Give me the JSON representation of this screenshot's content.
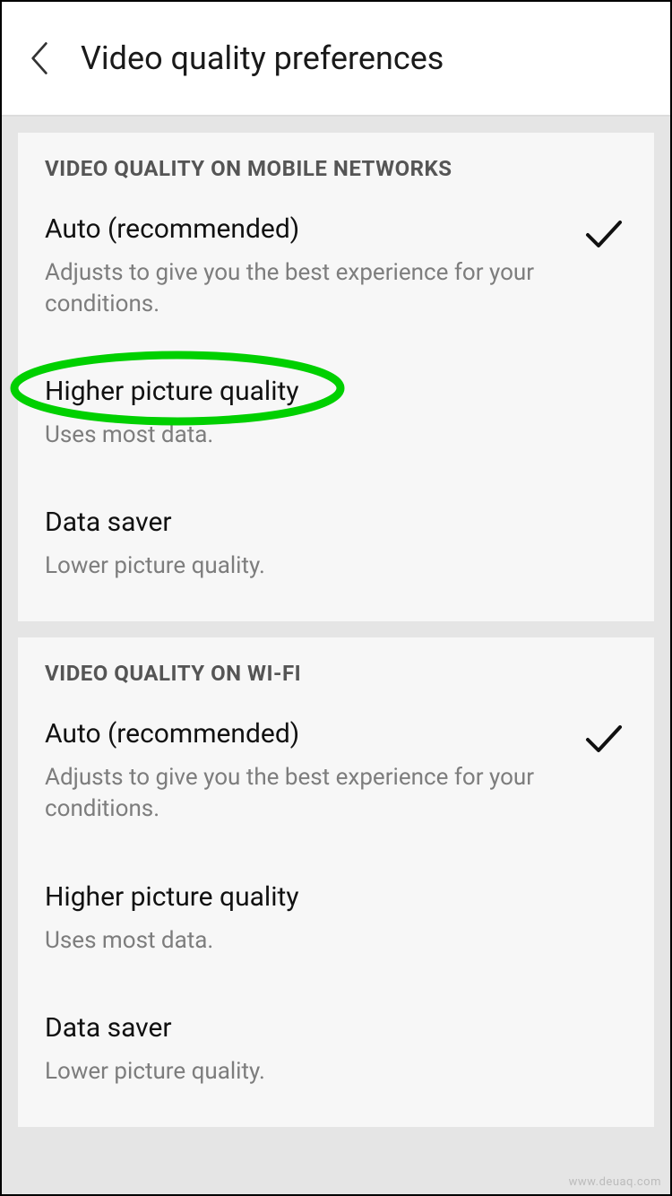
{
  "header": {
    "title": "Video quality preferences"
  },
  "sections": [
    {
      "header": "VIDEO QUALITY ON MOBILE NETWORKS",
      "options": [
        {
          "title": "Auto (recommended)",
          "desc": "Adjusts to give you the best experience for your conditions.",
          "selected": true
        },
        {
          "title": "Higher picture quality",
          "desc": "Uses most data.",
          "selected": false,
          "highlighted": true
        },
        {
          "title": "Data saver",
          "desc": "Lower picture quality.",
          "selected": false
        }
      ]
    },
    {
      "header": "VIDEO QUALITY ON WI-FI",
      "options": [
        {
          "title": "Auto (recommended)",
          "desc": "Adjusts to give you the best experience for your conditions.",
          "selected": true
        },
        {
          "title": "Higher picture quality",
          "desc": "Uses most data.",
          "selected": false
        },
        {
          "title": "Data saver",
          "desc": "Lower picture quality.",
          "selected": false
        }
      ]
    }
  ],
  "watermark": "www.deuaq.com",
  "colors": {
    "highlight": "#00d000"
  }
}
